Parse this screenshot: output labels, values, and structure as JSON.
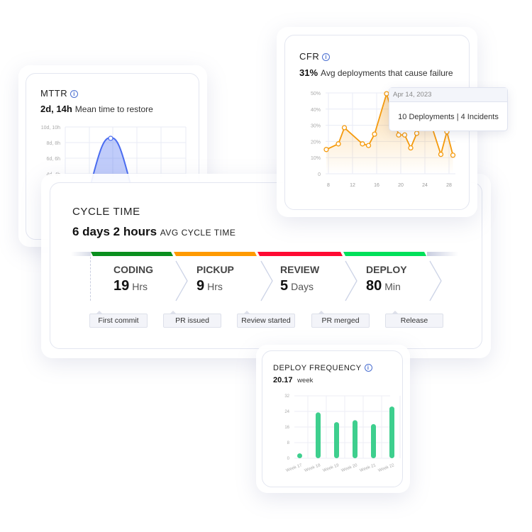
{
  "mttr": {
    "title": "MTTR",
    "value": "2d, 14h",
    "label": "Mean time to restore",
    "yticks": [
      "10d, 10h",
      "8d, 8h",
      "6d, 6h",
      "4d, 4h"
    ],
    "color": "#4a6cf0"
  },
  "cfr": {
    "title": "CFR",
    "value": "31%",
    "label": "Avg deployments that cause failure",
    "color": "#f59a0c",
    "tooltip": {
      "date": "Apr 14, 2023",
      "text": "10 Deployments | 4 Incidents"
    }
  },
  "cycle": {
    "title": "CYCLE TIME",
    "value": "6 days 2 hours",
    "label": "AVG CYCLE TIME",
    "stages": [
      {
        "name": "CODING",
        "value": "19",
        "unit": "Hrs",
        "color": "#0a8f1e"
      },
      {
        "name": "PICKUP",
        "value": "9",
        "unit": "Hrs",
        "color": "#ff9a00"
      },
      {
        "name": "REVIEW",
        "value": "5",
        "unit": "Days",
        "color": "#ff0a33"
      },
      {
        "name": "DEPLOY",
        "value": "80",
        "unit": "Min",
        "color": "#00e05a"
      }
    ],
    "events": [
      "First commit",
      "PR issued",
      "Review started",
      "PR merged",
      "Release"
    ]
  },
  "deploy": {
    "title": "DEPLOY FREQUENCY",
    "value": "20.17",
    "label": "week",
    "color": "#3ecf8e"
  },
  "chart_data": [
    {
      "type": "area",
      "title": "MTTR",
      "yticks": [
        "10d, 10h",
        "8d, 8h",
        "6d, 6h",
        "4d, 4h"
      ],
      "peak_value": "8d, 15h",
      "grid": true
    },
    {
      "type": "line",
      "title": "CFR",
      "x": [
        8,
        10,
        11,
        14,
        15,
        16,
        18,
        20,
        21,
        22,
        23,
        25,
        27,
        28,
        29
      ],
      "y": [
        15,
        18.5,
        28.5,
        18.5,
        17.5,
        24.5,
        49.5,
        24,
        24,
        16,
        25,
        35,
        12,
        26,
        11.5
      ],
      "xticks": [
        8,
        12,
        16,
        20,
        24,
        28
      ],
      "yticks": [
        "0",
        "10%",
        "20%",
        "30%",
        "40%",
        "50%"
      ],
      "ylim": [
        0,
        50
      ],
      "grid": true
    },
    {
      "type": "bar",
      "title": "DEPLOY FREQUENCY",
      "categories": [
        "Week 17",
        "Week 18",
        "Week 19",
        "Week 20",
        "Week 21",
        "Week 22"
      ],
      "values": [
        2.5,
        23.5,
        18.5,
        19.5,
        17.5,
        26.5
      ],
      "yticks": [
        0,
        8,
        16,
        24,
        32
      ],
      "ylim": [
        0,
        32
      ],
      "grid": true
    }
  ]
}
